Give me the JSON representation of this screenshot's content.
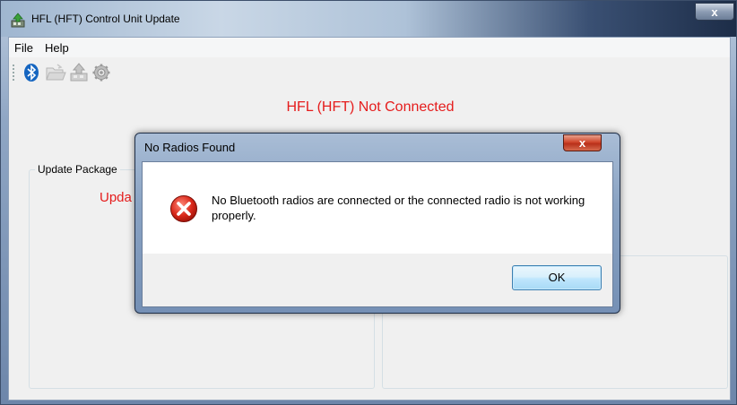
{
  "window": {
    "title": "HFL (HFT) Control Unit Update",
    "close_label": "x"
  },
  "menu": {
    "items": [
      {
        "label": "File"
      },
      {
        "label": "Help"
      }
    ]
  },
  "toolbar": {
    "buttons": [
      {
        "icon": "bluetooth-icon"
      },
      {
        "icon": "folder-open-icon"
      },
      {
        "icon": "upload-icon"
      },
      {
        "icon": "gear-icon"
      }
    ]
  },
  "status": {
    "text": "HFL (HFT) Not Connected",
    "color": "#e51c1c"
  },
  "update_package": {
    "legend": "Update Package",
    "label_visible": "Upda"
  },
  "dialog": {
    "title": "No Radios Found",
    "close_label": "x",
    "icon": "error-icon",
    "message": "No Bluetooth radios are connected or the connected radio is not working properly.",
    "ok_label": "OK"
  }
}
